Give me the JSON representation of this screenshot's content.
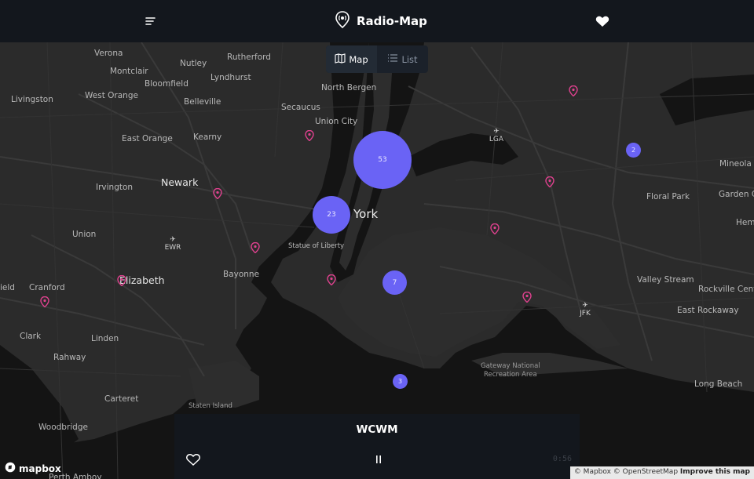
{
  "header": {
    "title": "Radio-Map",
    "menu_icon": "menu-icon",
    "logo_icon": "radio-pin-icon",
    "favorites_icon": "heart-icon"
  },
  "view_toggle": {
    "map_label": "Map",
    "list_label": "List",
    "active": "Map"
  },
  "map": {
    "places": [
      {
        "id": "verona",
        "text": "Verona"
      },
      {
        "id": "rutherford",
        "text": "Rutherford"
      },
      {
        "id": "nutley",
        "text": "Nutley"
      },
      {
        "id": "montclair",
        "text": "Montclair"
      },
      {
        "id": "lyndhurst",
        "text": "Lyndhurst"
      },
      {
        "id": "bloomfield",
        "text": "Bloomfield"
      },
      {
        "id": "north-bergen",
        "text": "North Bergen"
      },
      {
        "id": "livingston",
        "text": "Livingston"
      },
      {
        "id": "west-orange",
        "text": "West Orange"
      },
      {
        "id": "belleville",
        "text": "Belleville"
      },
      {
        "id": "secaucus",
        "text": "Secaucus"
      },
      {
        "id": "union-city",
        "text": "Union City"
      },
      {
        "id": "east-orange",
        "text": "East Orange"
      },
      {
        "id": "kearny",
        "text": "Kearny"
      },
      {
        "id": "newark",
        "text": "Newark"
      },
      {
        "id": "irvington",
        "text": "Irvington"
      },
      {
        "id": "york",
        "text": "York"
      },
      {
        "id": "union",
        "text": "Union"
      },
      {
        "id": "statue-of-liberty",
        "text": "Statue of Liberty"
      },
      {
        "id": "bayonne",
        "text": "Bayonne"
      },
      {
        "id": "elizabeth",
        "text": "Elizabeth"
      },
      {
        "id": "field",
        "text": "ield"
      },
      {
        "id": "cranford",
        "text": "Cranford"
      },
      {
        "id": "clark",
        "text": "Clark"
      },
      {
        "id": "linden",
        "text": "Linden"
      },
      {
        "id": "rahway",
        "text": "Rahway"
      },
      {
        "id": "carteret",
        "text": "Carteret"
      },
      {
        "id": "woodbridge",
        "text": "Woodbridge"
      },
      {
        "id": "perth-amboy",
        "text": "Perth Amboy"
      },
      {
        "id": "staten-island",
        "text": "Staten Island"
      },
      {
        "id": "mineola",
        "text": "Mineola"
      },
      {
        "id": "floral-park",
        "text": "Floral Park"
      },
      {
        "id": "garden-city",
        "text": "Garden C"
      },
      {
        "id": "hempstead",
        "text": "Hem"
      },
      {
        "id": "valley-stream",
        "text": "Valley Stream"
      },
      {
        "id": "rockville-centre",
        "text": "Rockville Cent"
      },
      {
        "id": "east-rockaway",
        "text": "East Rockaway"
      },
      {
        "id": "long-beach",
        "text": "Long Beach"
      },
      {
        "id": "gateway",
        "text": "Gateway National\nRecreation Area"
      }
    ],
    "airports": [
      {
        "id": "lga",
        "code": "LGA"
      },
      {
        "id": "ewr",
        "code": "EWR"
      },
      {
        "id": "jfk",
        "code": "JFK"
      }
    ],
    "clusters": [
      {
        "id": "c53",
        "count": "53"
      },
      {
        "id": "c23",
        "count": "23"
      },
      {
        "id": "c7",
        "count": "7"
      },
      {
        "id": "c3",
        "count": "3"
      },
      {
        "id": "c2",
        "count": "2"
      }
    ],
    "station_pin_color": "#e0418f",
    "cluster_color": "#6a63f5"
  },
  "player": {
    "station_name": "WCWM",
    "time": "0:56",
    "favorite_icon": "heart-outline-icon",
    "pause_icon": "pause-icon"
  },
  "footer": {
    "logo_text": "mapbox",
    "attribution": "© Mapbox © OpenStreetMap",
    "improve_link": "Improve this map"
  }
}
